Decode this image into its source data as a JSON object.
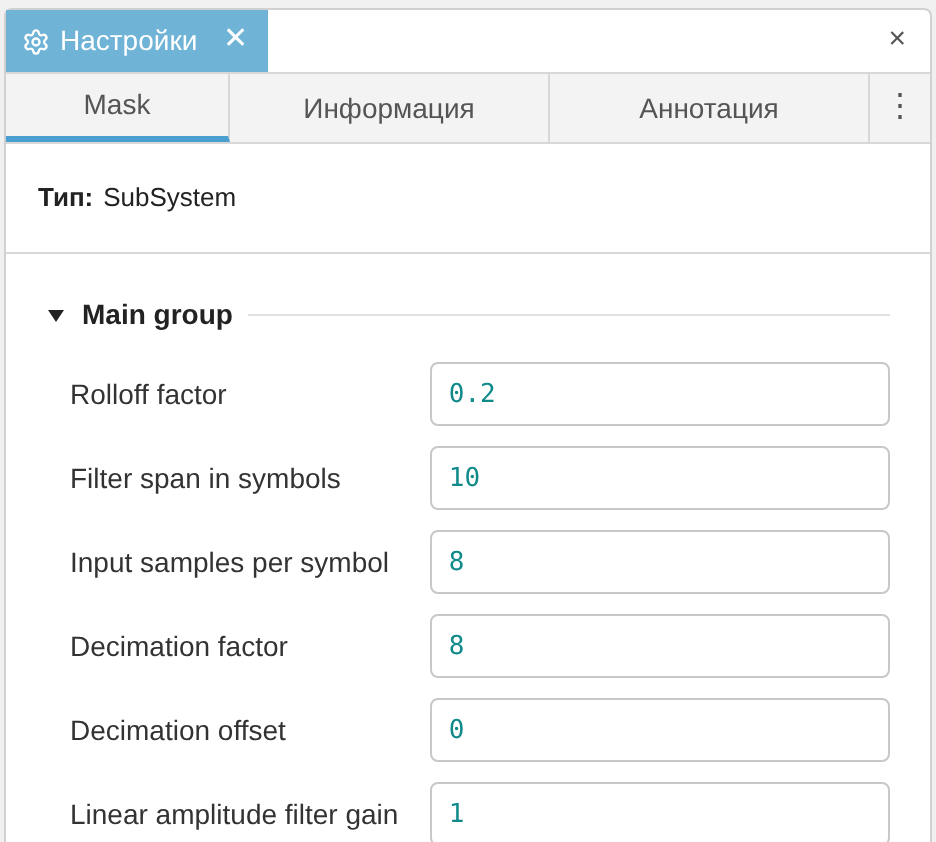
{
  "panel_tab": {
    "title": "Настройки",
    "close": "✕"
  },
  "window_close": "×",
  "tabs": [
    {
      "label": "Mask",
      "selected": true
    },
    {
      "label": "Информация",
      "selected": false
    },
    {
      "label": "Аннотация",
      "selected": false
    }
  ],
  "more": "⋮",
  "type": {
    "label": "Тип:",
    "value": "SubSystem"
  },
  "group": {
    "title": "Main group",
    "expanded": true,
    "params": [
      {
        "label": "Rolloff factor",
        "value": "0.2"
      },
      {
        "label": "Filter span in symbols",
        "value": "10"
      },
      {
        "label": "Input samples per symbol",
        "value": "8"
      },
      {
        "label": "Decimation factor",
        "value": "8"
      },
      {
        "label": "Decimation offset",
        "value": "0"
      },
      {
        "label": "Linear amplitude filter gain",
        "value": "1"
      }
    ]
  }
}
